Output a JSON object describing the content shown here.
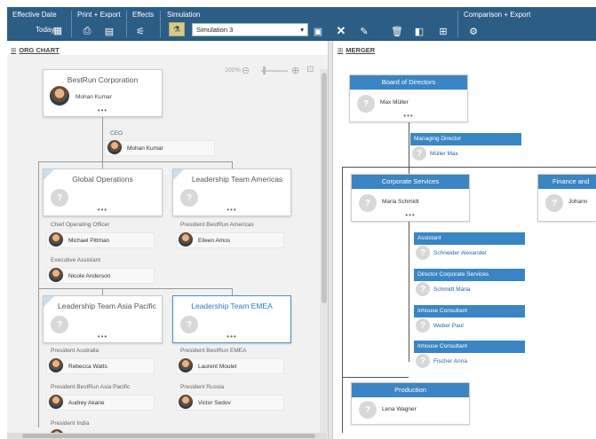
{
  "toolbar": {
    "effective_date_label": "Effective Date",
    "today_label": "Today",
    "print_export_label": "Print + Export",
    "effects_label": "Effects",
    "simulation_label": "Simulation",
    "simulation_value": "Simulation 3",
    "comparison_export_label": "Comparison + Export",
    "icons": [
      "calendar-icon",
      "print-icon",
      "save-icon",
      "effects-icon",
      "simulation-icon",
      "dropdown-arrow-icon",
      "copy-icon",
      "close-icon",
      "edit-icon",
      "delete-icon",
      "panel-icon",
      "add-icon",
      "settings-icon"
    ]
  },
  "left": {
    "title": "ORG CHART",
    "zoom_label": "100%",
    "root": {
      "title": "BestRun Corporation",
      "person": "Mohan Kumar",
      "more": "•••"
    },
    "ceo": {
      "role": "CEO",
      "person": "Mohan Kumar"
    },
    "units": [
      {
        "title": "Global Operations",
        "more": "•••"
      },
      {
        "title": "Leadership Team Americas",
        "more": "•••"
      },
      {
        "title": "Leadership Team Asia Pacific",
        "more": "•••"
      },
      {
        "title": "Leadership Team EMEA",
        "more": "•••"
      }
    ],
    "positions": [
      {
        "role": "Chief Operating Officer",
        "person": "Michael Pittman"
      },
      {
        "role": "Executive Assistant",
        "person": "Nicole Anderson"
      },
      {
        "role": "President BestRun Americas",
        "person": "Eileen Amos"
      },
      {
        "role": "President Australia",
        "person": "Rebecca Watts"
      },
      {
        "role": "President BestRun Asia Pacific",
        "person": "Audrey Akane"
      },
      {
        "role": "President India",
        "person": ""
      },
      {
        "role": "President BestRun EMEA",
        "person": "Laurent Moulet"
      },
      {
        "role": "President Russia",
        "person": "Victor Sedov"
      }
    ]
  },
  "right": {
    "title": "MERGER",
    "board": {
      "title": "Board of Directors",
      "person": "Max Müller",
      "more": "•••"
    },
    "managing": {
      "role": "Managing Director",
      "person": "Müller Max"
    },
    "corporate": {
      "title": "Corporate Services",
      "person": "Maria Schmidt",
      "more": "•••"
    },
    "finance": {
      "title": "Finance and",
      "person": "Johann"
    },
    "staff": [
      {
        "role": "Assistant",
        "person": "Schneider Alexander"
      },
      {
        "role": "Director Corporate Services",
        "person": "Schmidt Maria"
      },
      {
        "role": "Inhouse Consultant",
        "person": "Weber Paul"
      },
      {
        "role": "Inhouse Consultant",
        "person": "Fischer Anna"
      }
    ],
    "production": {
      "title": "Production",
      "person": "Lena Wagner"
    }
  },
  "colors": {
    "toolbar": "#2c5d85",
    "accent": "#3a85c4",
    "selected": "#2a7ac9"
  }
}
